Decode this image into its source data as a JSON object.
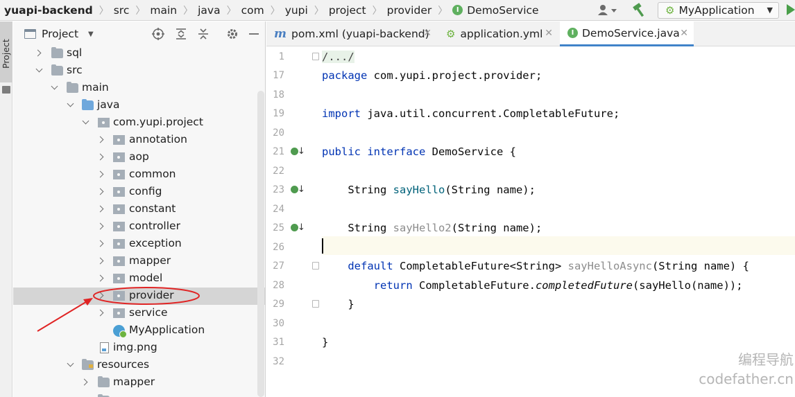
{
  "navbar": {
    "breadcrumb": [
      "yuapi-backend",
      "src",
      "main",
      "java",
      "com",
      "yupi",
      "project",
      "provider",
      "DemoService"
    ],
    "run_config": "MyApplication"
  },
  "stripe": {
    "label": "Project"
  },
  "project_panel": {
    "title": "Project",
    "tree": [
      {
        "label": "sql",
        "icon": "folder-icon",
        "expanded": false
      },
      {
        "label": "src",
        "icon": "folder-icon",
        "expanded": true
      },
      {
        "label": "main",
        "icon": "folder-icon",
        "expanded": true
      },
      {
        "label": "java",
        "icon": "source-folder-icon",
        "expanded": true
      },
      {
        "label": "com.yupi.project",
        "icon": "package-icon",
        "expanded": true
      },
      {
        "label": "annotation",
        "icon": "package-icon",
        "expanded": false
      },
      {
        "label": "aop",
        "icon": "package-icon",
        "expanded": false
      },
      {
        "label": "common",
        "icon": "package-icon",
        "expanded": false
      },
      {
        "label": "config",
        "icon": "package-icon",
        "expanded": false
      },
      {
        "label": "constant",
        "icon": "package-icon",
        "expanded": false
      },
      {
        "label": "controller",
        "icon": "package-icon",
        "expanded": false
      },
      {
        "label": "exception",
        "icon": "package-icon",
        "expanded": false
      },
      {
        "label": "mapper",
        "icon": "package-icon",
        "expanded": false
      },
      {
        "label": "model",
        "icon": "package-icon",
        "expanded": false
      },
      {
        "label": "provider",
        "icon": "package-icon",
        "expanded": false,
        "selected": true
      },
      {
        "label": "service",
        "icon": "package-icon",
        "expanded": false
      },
      {
        "label": "MyApplication",
        "icon": "spring-app-icon"
      },
      {
        "label": "img.png",
        "icon": "image-file-icon"
      },
      {
        "label": "resources",
        "icon": "resources-folder-icon",
        "expanded": true
      },
      {
        "label": "mapper",
        "icon": "folder-icon",
        "expanded": false
      }
    ]
  },
  "editor": {
    "tabs": [
      {
        "label": "pom.xml (yuapi-backend)",
        "icon": "maven-icon",
        "active": false
      },
      {
        "label": "application.yml",
        "icon": "spring-config-icon",
        "active": false
      },
      {
        "label": "DemoService.java",
        "icon": "interface-icon",
        "active": true
      }
    ],
    "line_numbers": [
      "1",
      "17",
      "18",
      "19",
      "20",
      "21",
      "22",
      "23",
      "24",
      "25",
      "26",
      "27",
      "28",
      "29",
      "30",
      "31",
      "32"
    ],
    "code": {
      "l1": "/.../",
      "l17_kw": "package",
      "l17_rest": " com.yupi.project.provider;",
      "l19_kw": "import",
      "l19_rest": " java.util.concurrent.CompletableFuture;",
      "l21_kw1": "public",
      "l21_kw2": "interface",
      "l21_rest": " DemoService {",
      "l23_type": "String ",
      "l23_fn": "sayHello",
      "l23_rest": "(String name);",
      "l25_type": "String ",
      "l25_fn": "sayHello2",
      "l25_rest": "(String name);",
      "l27_kw": "default",
      "l27_type": " CompletableFuture<String> ",
      "l27_fn": "sayHelloAsync",
      "l27_rest": "(String name) {",
      "l28_kw": "return",
      "l28_mid": " CompletableFuture.",
      "l28_it": "completedFuture",
      "l28_rest": "(sayHello(name));",
      "l29": "}",
      "l31": "}"
    }
  },
  "watermark": {
    "line1": "编程导航",
    "line2": "codefather.cn"
  },
  "colors": {
    "keyword": "#0033b3",
    "method": "#00627a",
    "unused_method": "#8c8c8c",
    "accent": "#4083c9",
    "annotation_red": "#e02424"
  }
}
